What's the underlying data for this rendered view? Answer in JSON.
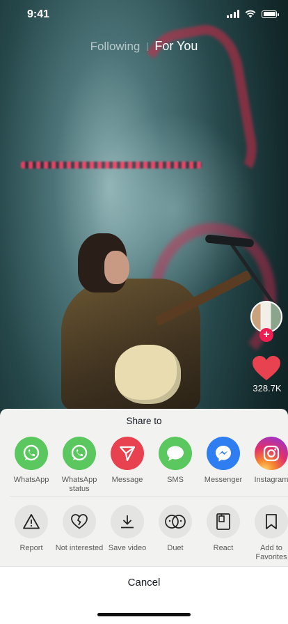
{
  "status_bar": {
    "time": "9:41"
  },
  "feed_tabs": {
    "following": "Following",
    "for_you": "For You"
  },
  "right_rail": {
    "like_count": "328.7K",
    "follow_symbol": "+"
  },
  "share_sheet": {
    "title": "Share to",
    "share_targets": [
      {
        "label": "WhatsApp",
        "icon": "whatsapp-icon",
        "color": "#5ac85f"
      },
      {
        "label": "WhatsApp status",
        "icon": "whatsapp-status-icon",
        "color": "#5ac85f"
      },
      {
        "label": "Message",
        "icon": "send-icon",
        "color": "#e8414f"
      },
      {
        "label": "SMS",
        "icon": "sms-bubble-icon",
        "color": "#5ac85f"
      },
      {
        "label": "Messenger",
        "icon": "messenger-icon",
        "color": "#2e7ef2"
      },
      {
        "label": "Instagram",
        "icon": "instagram-icon",
        "color": "#d63f8c"
      }
    ],
    "actions": [
      {
        "label": "Report",
        "icon": "warning-icon"
      },
      {
        "label": "Not interested",
        "icon": "broken-heart-icon"
      },
      {
        "label": "Save video",
        "icon": "download-icon"
      },
      {
        "label": "Duet",
        "icon": "duet-icon"
      },
      {
        "label": "React",
        "icon": "react-icon"
      },
      {
        "label": "Add to Favorites",
        "icon": "bookmark-icon"
      }
    ],
    "cancel_label": "Cancel"
  },
  "colors": {
    "accent_red": "#ee1d52",
    "heart": "#e8414f"
  }
}
